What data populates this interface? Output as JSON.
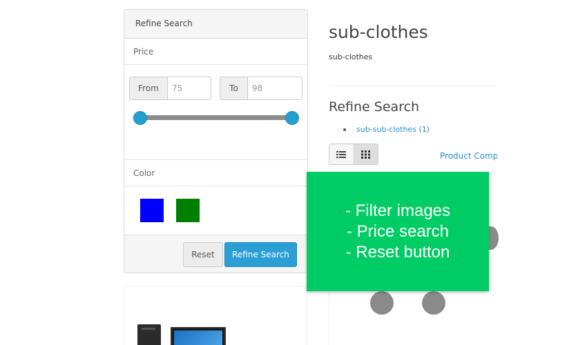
{
  "filter_panel": {
    "title": "Refine Search",
    "price": {
      "label": "Price",
      "from_label": "From",
      "from_value": "75",
      "to_label": "To",
      "to_value": "98"
    },
    "color": {
      "label": "Color",
      "swatches": [
        "#0000ff",
        "#008000"
      ]
    },
    "reset_label": "Reset",
    "refine_label": "Refine Search",
    "accent_color": "#2a9fd6"
  },
  "content": {
    "title": "sub-clothes",
    "description": "sub-clothes",
    "refine_title": "Refine Search",
    "subcategories": [
      {
        "label": "sub-sub-clothes (1)"
      }
    ],
    "compare_label": "Product Compa"
  },
  "overlay": {
    "lines": [
      "- Filter images",
      "- Price search",
      "- Reset button"
    ],
    "color": "#00cc66"
  }
}
